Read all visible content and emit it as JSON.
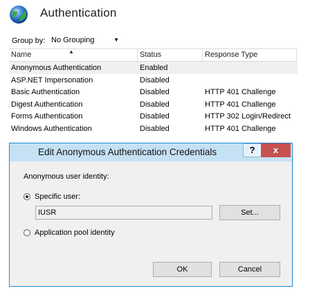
{
  "page": {
    "title": "Authentication"
  },
  "groupby": {
    "label": "Group by:",
    "value": "No Grouping"
  },
  "table": {
    "columns": [
      "Name",
      "Status",
      "Response Type"
    ],
    "rows": [
      [
        "Anonymous Authentication",
        "Enabled",
        ""
      ],
      [
        "ASP.NET Impersonation",
        "Disabled",
        ""
      ],
      [
        "Basic Authentication",
        "Disabled",
        "HTTP 401 Challenge"
      ],
      [
        "Digest Authentication",
        "Disabled",
        "HTTP 401 Challenge"
      ],
      [
        "Forms Authentication",
        "Disabled",
        "HTTP 302 Login/Redirect"
      ],
      [
        "Windows Authentication",
        "Disabled",
        "HTTP 401 Challenge"
      ]
    ]
  },
  "dialog": {
    "title": "Edit Anonymous Authentication Credentials",
    "help_label": "?",
    "close_label": "x",
    "identity_label": "Anonymous user identity:",
    "specific_user_label": "Specific user:",
    "specific_user_value": "IUSR",
    "set_label": "Set...",
    "app_pool_label": "Application pool identity",
    "ok_label": "OK",
    "cancel_label": "Cancel"
  },
  "icons": {
    "globe": "globe-icon",
    "dropdown": "chevron-down-icon",
    "sort": "sort-ascending-icon"
  }
}
